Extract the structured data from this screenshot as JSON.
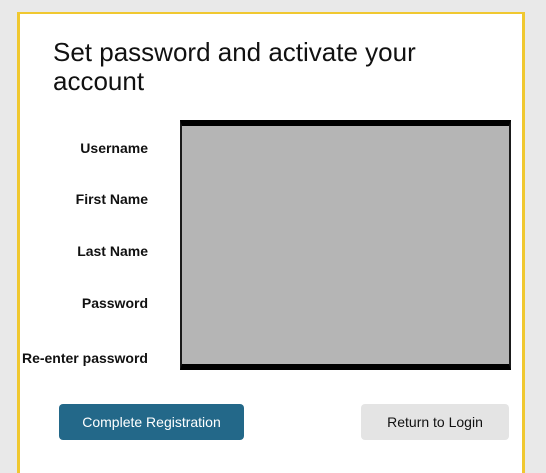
{
  "form": {
    "title": "Set password and activate your account",
    "fields": [
      {
        "label": "Username"
      },
      {
        "label": "First Name"
      },
      {
        "label": "Last Name"
      },
      {
        "label": "Password"
      },
      {
        "label": "Re-enter password"
      }
    ]
  },
  "actions": {
    "complete_label": "Complete Registration",
    "return_label": "Return to Login"
  },
  "colors": {
    "accent_border": "#f0c830",
    "primary_button": "#236889",
    "secondary_button": "#e4e4e4",
    "redaction": "#b5b5b5"
  }
}
